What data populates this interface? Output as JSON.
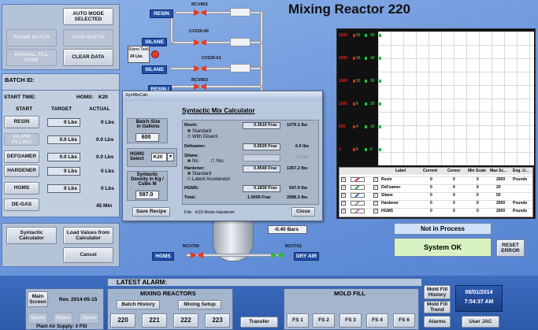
{
  "page_title": "Mixing Reactor 220",
  "top_buttons": {
    "auto_mode": "AUTO MODE SELECTED",
    "pause_batch": "PAUSE BATCH",
    "stop_batch": "STOP BATCH",
    "manual_fill": "MANUAL FILL DONE",
    "clear_data": "CLEAR DATA"
  },
  "batch": {
    "batch_id_label": "BATCH ID:",
    "start_time_label": "START TIME:",
    "hgms_label": "HGMS:",
    "hgms_value": "K20",
    "col_start": "START",
    "col_target": "TARGET",
    "col_actual": "ACTUAL",
    "rows": [
      {
        "name": "RESIN",
        "target": "0 Lbs",
        "actual": "0 Lbs"
      },
      {
        "name": "SILANE FILLING",
        "target": "0.0 Lbs",
        "actual": "0.0 Lbs"
      },
      {
        "name": "DEFOAMER",
        "target": "0.0 Lbs",
        "actual": "0.0 Lbs"
      },
      {
        "name": "HARDENER",
        "target": "0 Lbs",
        "actual": "0 Lbs"
      },
      {
        "name": "HGMS",
        "target": "0 Lbs",
        "actual": "0 Lbs"
      },
      {
        "name": "DE-GAS",
        "target": "",
        "actual": "45 Min"
      }
    ]
  },
  "calc_buttons": {
    "syntactic": "Syntactic Calculator",
    "load_values": "Load Values from Calculator",
    "cancel": "Cancel"
  },
  "process": {
    "rcv802": "RCV802",
    "resin_top": "RESIN",
    "cv220_00": "CV220-00",
    "silane_a": "SILANE",
    "silane_tank": "Silane Tank",
    "silane_tank_qty": "24 Lbs",
    "cv220_01": "CV220-01",
    "silane_b": "SILANE",
    "rcv803": "RCV803",
    "resin_slash": "RESIN /",
    "rcv700": "RCV700",
    "hgms_tag": "HGMS",
    "rcv702": "RCV702",
    "dry_air": "DRY AIR",
    "pressure": "-0.40 Bars"
  },
  "dialog": {
    "window_title": "SynMixCalc",
    "heading": "Syntactic Mix Calculator",
    "batch_size_label": "Batch Size in Gallons",
    "batch_size_value": "600",
    "hgms_select_label": "HGMS Select",
    "hgms_select_value": "K20",
    "density_label": "Syntactic Density in Kg / Cubic M",
    "density_value": "597.0",
    "resin_label": "Resin:",
    "resin_frac": "0.3610 Frac",
    "resin_lbs": "1079.1 lbs",
    "resin_opt1": "Standard",
    "resin_opt2": "With Diluent",
    "defoamer_label": "Defoamer:",
    "defoamer_frac": "0.0020 Frac",
    "defoamer_lbs": "6.0 lbs",
    "silane_label": "Silane:",
    "silane_no": "No",
    "silane_yes": "Yes",
    "silane_lbs": "0.0 lbs",
    "hardener_label": "Hardener:",
    "hardener_frac": "0.4540 Frac",
    "hardener_lbs": "1357.2 lbs",
    "hardener_opt1": "Standard",
    "hardener_opt2": "Latent Accelerator",
    "hgms_label": "HGMS:",
    "hgms_frac": "0.1830 Frac",
    "hgms_lbs": "547.0 lbs",
    "total_label": "Total:",
    "total_frac": "1.0000 Frac",
    "total_lbs": "2989.3 lbs",
    "save_recipe": "Save Recipe",
    "file_label": "File:",
    "file_value": "K20 Resin Hardener",
    "close": "Close"
  },
  "trend": {
    "scale_red": [
      "2500",
      "2000",
      "1500",
      "1000",
      "500",
      "0"
    ],
    "scale_g1": [
      "20",
      "16",
      "12",
      "8",
      "4",
      "0"
    ],
    "scale_g2": [
      "50",
      "40",
      "30",
      "20",
      "10",
      "0"
    ],
    "headers": [
      "Label",
      "Current",
      "Cursor",
      "Min Scale",
      "Max Sc...",
      "Eng. U..."
    ],
    "rows": [
      {
        "label": "Resin",
        "current": "0",
        "cursor": "0",
        "min": "0",
        "max": "2500",
        "eng": "Pounds"
      },
      {
        "label": "DeFoamer",
        "current": "0",
        "cursor": "0",
        "min": "0",
        "max": "20",
        "eng": ""
      },
      {
        "label": "Silane",
        "current": "0",
        "cursor": "0",
        "min": "0",
        "max": "50",
        "eng": ""
      },
      {
        "label": "Hardener",
        "current": "0",
        "cursor": "0",
        "min": "0",
        "max": "2500",
        "eng": "Pounds"
      },
      {
        "label": "HGMS",
        "current": "0",
        "cursor": "0",
        "min": "0",
        "max": "2500",
        "eng": "Pounds"
      }
    ]
  },
  "status": {
    "not_in_process": "Not in Process",
    "system_ok": "System OK",
    "reset_error": "RESET ERROR"
  },
  "footer": {
    "latest_alarm": "LATEST ALARM:",
    "main_screen": "Main Screen",
    "rev": "Rev. 2014-05-15",
    "spare1": "Spare",
    "spare2": "Spare",
    "spare3": "Spare",
    "plant_air": "Plant Air Supply: 0 PSI",
    "mixing_reactors": "MIXING REACTORS",
    "batch_history": "Batch History",
    "mixing_setup": "Mixing Setup",
    "r220": "220",
    "r221": "221",
    "r222": "222",
    "r223": "223",
    "transfer": "Transfer",
    "mold_fill": "MOLD FILL",
    "fs1": "FS 1",
    "fs2": "FS 2",
    "fs3": "FS 3",
    "fs4": "FS 4",
    "fs6": "FS 6",
    "mold_fill_history": "Mold Fill History",
    "mold_fill_trend": "Mold Fill Trend",
    "alarms": "Alarms",
    "date": "08/01/2014",
    "time": "7:54:37 AM",
    "user_jac": "User JAC"
  }
}
